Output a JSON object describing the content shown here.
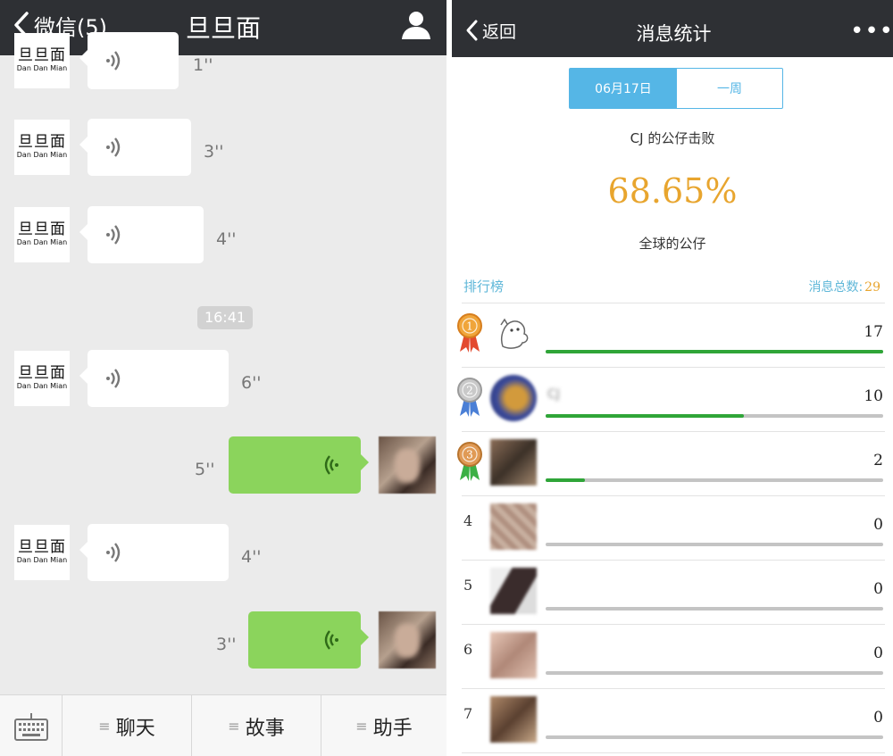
{
  "left": {
    "nav": {
      "back_label": "微信(5)",
      "title": "旦旦面"
    },
    "incoming_logo": {
      "top": "旦旦面",
      "bottom": "Dan Dan Mian"
    },
    "messages": [
      {
        "direction": "in",
        "duration": "1''"
      },
      {
        "direction": "in",
        "duration": "3''"
      },
      {
        "direction": "in",
        "duration": "4''"
      },
      {
        "direction": "in",
        "duration": "6''"
      },
      {
        "direction": "out",
        "duration": "5''"
      },
      {
        "direction": "in",
        "duration": "4''"
      },
      {
        "direction": "out",
        "duration": "3''"
      }
    ],
    "time_badge": "16:41",
    "bottom_menu": [
      "聊天",
      "故事",
      "助手"
    ],
    "icons": {
      "back": "chevron-left-icon",
      "profile": "person-icon",
      "keyboard": "keyboard-icon",
      "voice": "voice-wave-icon",
      "menu": "menu-lines-icon"
    },
    "colors": {
      "nav": "#2e3034",
      "outgoing_bubble": "#8bd45c",
      "background": "#ebebeb"
    }
  },
  "right": {
    "nav": {
      "back_label": "返回",
      "title": "消息统计",
      "more": "•••"
    },
    "segment": {
      "options": [
        "06月17日",
        "一周"
      ],
      "selected": "06月17日"
    },
    "beat_text": "CJ 的公仔击败",
    "percent": "68.65%",
    "global_text": "全球的公仔",
    "leaderboard": {
      "title": "排行榜",
      "total_label": "消息总数:",
      "total_value": "29",
      "max_value": 17,
      "rows": [
        {
          "rank": "1",
          "medal": "gold",
          "name": "",
          "count": "17",
          "value": 17
        },
        {
          "rank": "2",
          "medal": "silver",
          "name": "CJ",
          "count": "10",
          "value": 10
        },
        {
          "rank": "3",
          "medal": "bronze",
          "name": "",
          "count": "2",
          "value": 2
        },
        {
          "rank": "4",
          "medal": "",
          "name": "",
          "count": "0",
          "value": 0
        },
        {
          "rank": "5",
          "medal": "",
          "name": "",
          "count": "0",
          "value": 0
        },
        {
          "rank": "6",
          "medal": "",
          "name": "",
          "count": "0",
          "value": 0
        },
        {
          "rank": "7",
          "medal": "",
          "name": "",
          "count": "0",
          "value": 0
        }
      ]
    },
    "colors": {
      "accent": "#55b6e6",
      "percent": "#e8a52e",
      "bar": "#2fa538",
      "track": "#c4c4c4"
    }
  }
}
